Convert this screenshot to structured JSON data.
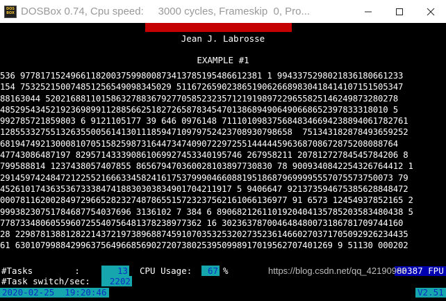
{
  "window": {
    "title": "DOSBox 0.74, Cpu speed:     3000 cycles, Frameskip  0, Pro...",
    "icon_text": "DOS BOX"
  },
  "header": {
    "author": "Jean J. Labrosse",
    "example": "EXAMPLE #1"
  },
  "number_lines": [
    "536 977817152496611820037599800873413785195486612381 1 9943375298021836180661233",
    "154 753252150074851256549098345029 511672659023865190626689830418414107151505347",
    "88163044 5202168811015863278836792770585232357121919897229655825146249873280278",
    "48529543452192369899112885662518272658783454701386894906490668652397833318010 5",
    "992785721859803 6 9121105177 39 646 0976148 7111010983756848346694238894061782761",
    "1285533275513263550056141301118594710979752423708930798658  751343182878493659252",
    "6819474921300081070515825987316447347409072297255144444596368708672875208088764",
    "47743086487197 829571433390861069927453340195746 267958211 20781272784545784206 8",
    "799588814 1237438057407855 865679470360028103897730830 78 9009340842254326764412 1",
    "291459742484721225521666334582416175379990466088195186879699995557075573750073 79",
    "4526101743635367333847418830303834901704211917 5 9406647 921373594675385628848472",
    "000781162002849729665282327487865515723237562161066136977 91 6573 12454937852165 2",
    "99938230751784687754037696 3136102 7 384 6 8906821261101920404135785203583480438 5",
    "7787334806055960725540756481378238977362 16 302363787004648480073186781709744160",
    "28 229878138812822143721973896887459107035325320273523614660270371705092926234435",
    "61 630107998842996375649668569027207380253950998917019562707401269 9 51130 000202"
  ],
  "status": {
    "tasks_label": "#Tasks        :",
    "tasks_value": "13",
    "cpu_label": "CPU Usage:",
    "cpu_value": "67",
    "cpu_unit": "%",
    "fpu": "80387 FPU",
    "switch_label": "#Task switch/sec:",
    "switch_value": "2202",
    "datetime": "2020-02-25  19:20:46",
    "version": "V2.51"
  },
  "watermark": "https://blog.csdn.net/qq_42190908",
  "colors": {
    "status_value_bg": "#16a6ad",
    "status_value_fg": "#0b2fc0",
    "info_box_bg": "#0000b0",
    "title_bar_accent": "#c40000"
  }
}
